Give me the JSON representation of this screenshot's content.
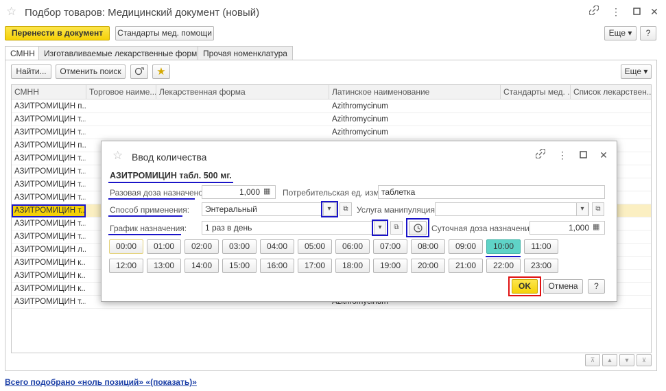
{
  "window": {
    "title": "Подбор товаров: Медицинский документ (новый)",
    "controls": [
      "link-icon",
      "more-icon",
      "maximize-icon",
      "close-icon"
    ]
  },
  "toolbar": {
    "transfer_label": "Перенести в документ",
    "standards_label": "Стандарты мед. помощи",
    "more_label": "Еще",
    "help_label": "?"
  },
  "tabs": [
    {
      "label": "СМНН",
      "active": true
    },
    {
      "label": "Изготавливаемые лекарственные формы",
      "active": false
    },
    {
      "label": "Прочая номенклатура",
      "active": false
    }
  ],
  "list_toolbar": {
    "find_label": "Найти...",
    "cancel_search_label": "Отменить поиск",
    "more_label": "Еще"
  },
  "grid": {
    "columns": [
      "СМНН",
      "Торговое наиме...",
      "Лекарственная форма",
      "Латинское наименование",
      "Стандарты мед. ...",
      "Список лекарствен..."
    ],
    "rows": [
      {
        "smnn": "АЗИТРОМИЦИН п...",
        "latin": "Azithromycinum"
      },
      {
        "smnn": "АЗИТРОМИЦИН т...",
        "latin": "Azithromycinum"
      },
      {
        "smnn": "АЗИТРОМИЦИН т...",
        "latin": "Azithromycinum"
      },
      {
        "smnn": "АЗИТРОМИЦИН п...",
        "latin": ""
      },
      {
        "smnn": "АЗИТРОМИЦИН т...",
        "latin": ""
      },
      {
        "smnn": "АЗИТРОМИЦИН т...",
        "latin": ""
      },
      {
        "smnn": "АЗИТРОМИЦИН т...",
        "latin": ""
      },
      {
        "smnn": "АЗИТРОМИЦИН т...",
        "latin": ""
      },
      {
        "smnn": "АЗИТРОМИЦИН т...",
        "latin": "",
        "selected": true
      },
      {
        "smnn": "АЗИТРОМИЦИН т...",
        "latin": ""
      },
      {
        "smnn": "АЗИТРОМИЦИН т...",
        "latin": ""
      },
      {
        "smnn": "АЗИТРОМИЦИН л...",
        "latin": ""
      },
      {
        "smnn": "АЗИТРОМИЦИН к...",
        "latin": ""
      },
      {
        "smnn": "АЗИТРОМИЦИН к...",
        "latin": ""
      },
      {
        "smnn": "АЗИТРОМИЦИН к...",
        "latin": ""
      },
      {
        "smnn": "АЗИТРОМИЦИН т...",
        "latin": "Azithromycinum"
      }
    ]
  },
  "footer": {
    "summary": "Всего подобрано «ноль позиций» «(показать)»"
  },
  "dialog": {
    "title": "Ввод количества",
    "product": "АЗИТРОМИЦИН табл. 500 мг.",
    "single_dose_label": "Разовая доза назначено:",
    "single_dose_value": "1,000",
    "consumer_unit_label": "Потребительская ед. изм.:",
    "consumer_unit_value": "таблетка",
    "method_label": "Способ применения:",
    "method_value": "Энтеральный",
    "service_label": "Услуга манипуляция:",
    "service_value": "",
    "schedule_label": "График назначения:",
    "schedule_value": "1 раз в день",
    "daily_dose_label": "Суточная доза назначения:",
    "daily_dose_value": "1,000",
    "hours": [
      "00:00",
      "01:00",
      "02:00",
      "03:00",
      "04:00",
      "05:00",
      "06:00",
      "07:00",
      "08:00",
      "09:00",
      "10:00",
      "11:00",
      "12:00",
      "13:00",
      "14:00",
      "15:00",
      "16:00",
      "17:00",
      "18:00",
      "19:00",
      "20:00",
      "21:00",
      "22:00",
      "23:00"
    ],
    "selected_hour": "10:00",
    "ok_label": "OK",
    "cancel_label": "Отмена",
    "help_label": "?"
  },
  "colors": {
    "accent_yellow": "#f5d108",
    "highlight_blue": "#1a14c8",
    "highlight_red": "#e01010",
    "selected_hour": "#5fd3c7",
    "selected_row": "#fbefc2"
  }
}
